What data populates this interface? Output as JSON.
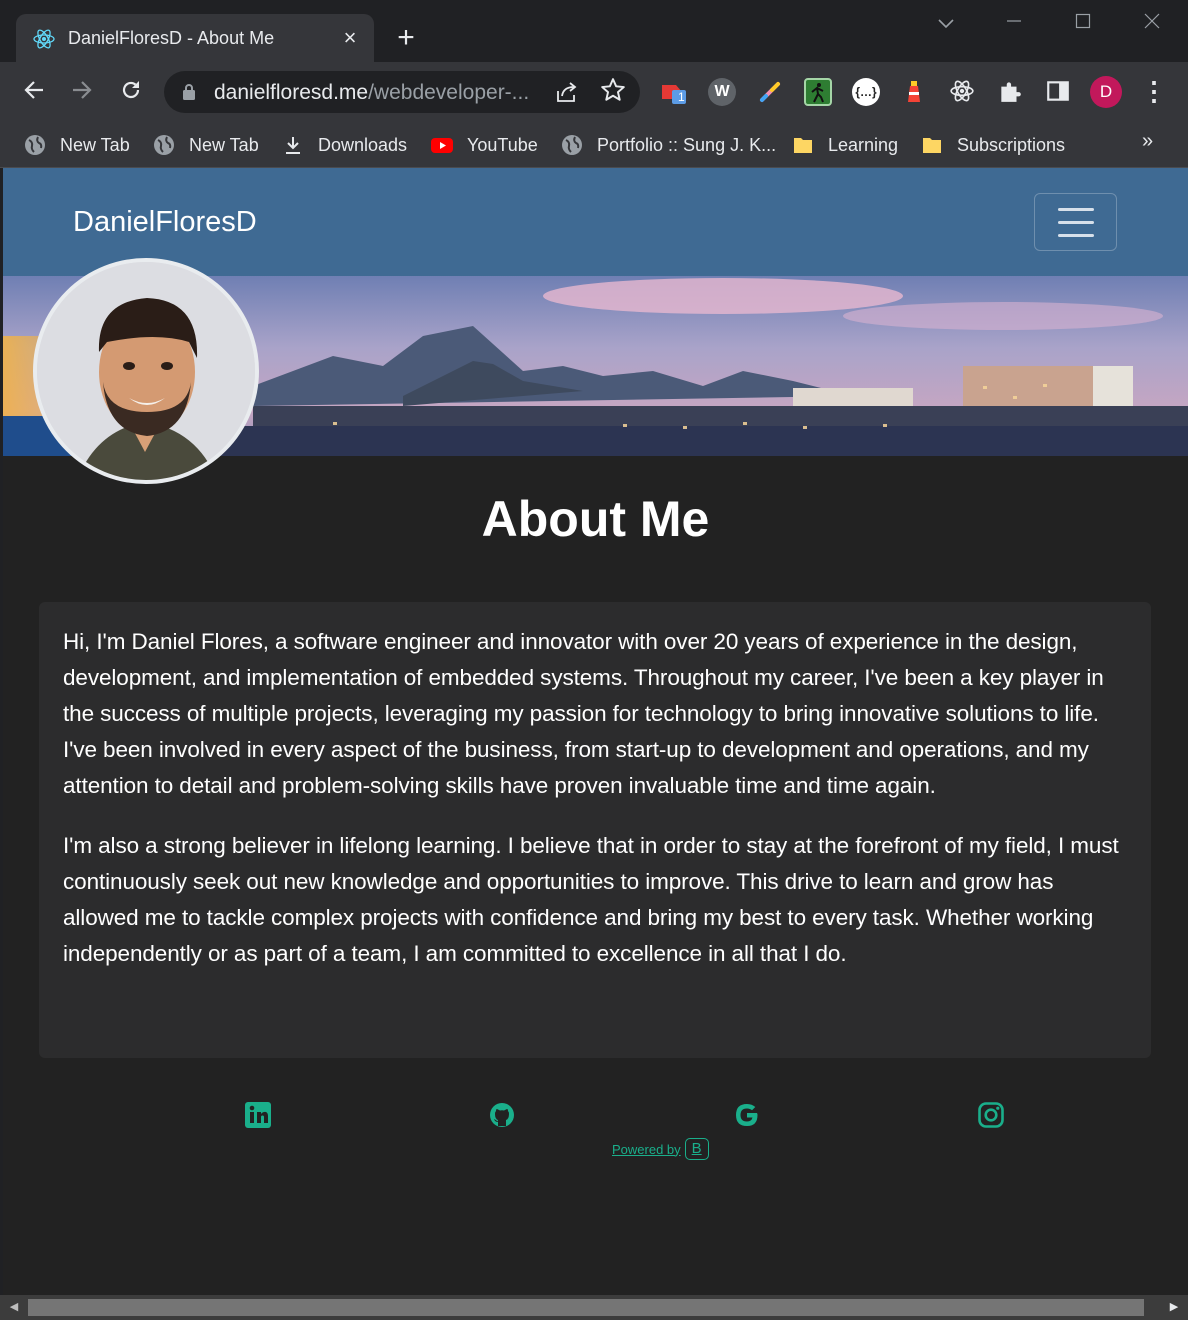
{
  "browser": {
    "tab_title": "DanielFloresD - About Me",
    "tab_close": "×",
    "new_tab": "+",
    "url_host": "danielfloresd.me",
    "url_path": "/webdeveloper-...",
    "profile_initial": "D",
    "extension_badge": "1",
    "bookmarks": [
      {
        "label": "New Tab",
        "icon": "globe-icon"
      },
      {
        "label": "New Tab",
        "icon": "globe-icon"
      },
      {
        "label": "Downloads",
        "icon": "download-icon"
      },
      {
        "label": "YouTube",
        "icon": "youtube-icon"
      },
      {
        "label": "Portfolio :: Sung J. K...",
        "icon": "globe-icon"
      },
      {
        "label": "Learning",
        "icon": "folder-icon"
      },
      {
        "label": "Subscriptions",
        "icon": "folder-icon"
      }
    ],
    "bookmarks_more": "»"
  },
  "site": {
    "brand": "DanielFloresD",
    "page_title": "About Me",
    "paragraphs": [
      "Hi, I'm Daniel Flores, a software engineer and innovator with over 20 years of experience in the design, development, and implementation of embedded systems. Throughout my career, I've been a key player in the success of multiple projects, leveraging my passion for technology to bring innovative solutions to life. I've been involved in every aspect of the business, from start-up to development and operations, and my attention to detail and problem-solving skills have proven invaluable time and time again.",
      "I'm also a strong believer in lifelong learning. I believe that in order to stay at the forefront of my field, I must continuously seek out new knowledge and opportunities to improve. This drive to learn and grow has allowed me to tackle complex projects with confidence and bring my best to every task. Whether working independently or as part of a team, I am committed to excellence in all that I do."
    ],
    "social": [
      "linkedin-icon",
      "github-icon",
      "google-icon",
      "instagram-icon"
    ],
    "powered_by": "Powered by",
    "bootstrap_letter": "B"
  },
  "colors": {
    "navbar": "#3f6a93",
    "accent": "#1aaf8b",
    "page_bg": "#222222",
    "card_bg": "#2c2c2d"
  }
}
